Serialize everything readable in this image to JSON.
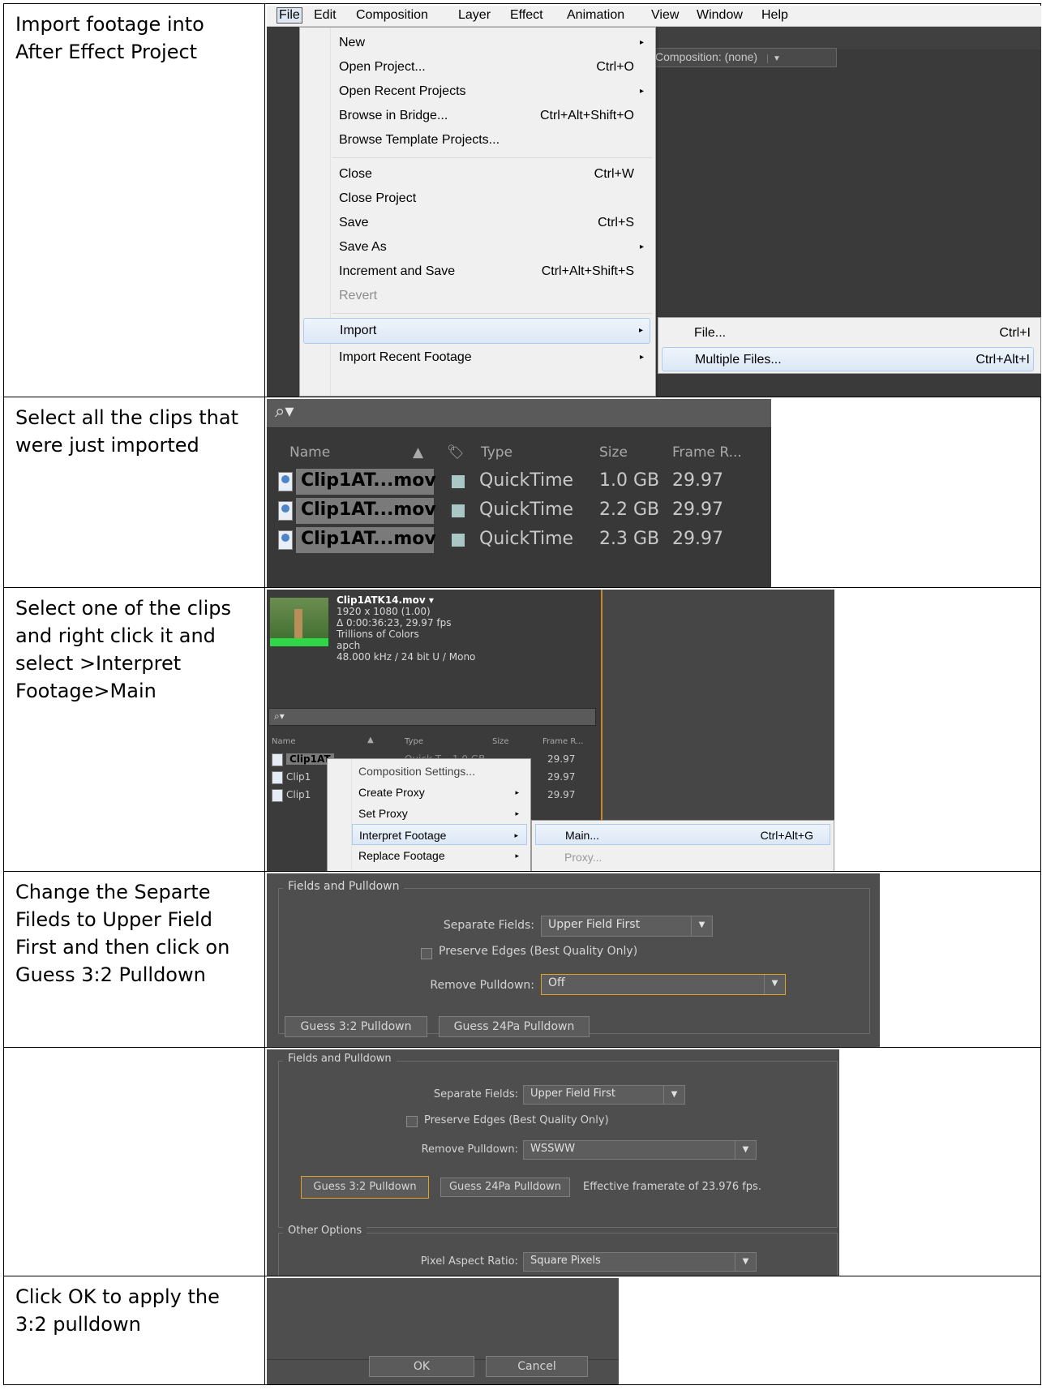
{
  "steps": [
    "Import footage into After Effect Project",
    "Select all the clips that were just imported",
    "Select one of the clips and right click it and select >Interpret Footage>Main",
    "Change the Separte Fileds to Upper Field First and then click on Guess 3:2 Pulldown",
    "",
    "Click OK to apply the 3:2 pulldown"
  ],
  "menubar": [
    "File",
    "Edit",
    "Composition",
    "Layer",
    "Effect",
    "Animation",
    "View",
    "Window",
    "Help"
  ],
  "comp_tab": "Composition: (none)",
  "file_menu": [
    {
      "label": "New",
      "shortcut": "",
      "arrow": "▸"
    },
    {
      "label": "Open Project...",
      "shortcut": "Ctrl+O",
      "arrow": ""
    },
    {
      "label": "Open Recent Projects",
      "shortcut": "",
      "arrow": "▸"
    },
    {
      "label": "Browse in Bridge...",
      "shortcut": "Ctrl+Alt+Shift+O",
      "arrow": ""
    },
    {
      "label": "Browse Template Projects...",
      "shortcut": "",
      "arrow": ""
    },
    {
      "label": "Close",
      "shortcut": "Ctrl+W",
      "arrow": ""
    },
    {
      "label": "Close Project",
      "shortcut": "",
      "arrow": ""
    },
    {
      "label": "Save",
      "shortcut": "Ctrl+S",
      "arrow": ""
    },
    {
      "label": "Save As",
      "shortcut": "",
      "arrow": "▸"
    },
    {
      "label": "Increment and Save",
      "shortcut": "Ctrl+Alt+Shift+S",
      "arrow": ""
    },
    {
      "label": "Revert",
      "shortcut": "",
      "arrow": ""
    },
    {
      "label": "Import",
      "shortcut": "",
      "arrow": "▸"
    },
    {
      "label": "Import Recent Footage",
      "shortcut": "",
      "arrow": "▸"
    }
  ],
  "import_submenu": [
    {
      "label": "File...",
      "shortcut": "Ctrl+I"
    },
    {
      "label": "Multiple Files...",
      "shortcut": "Ctrl+Alt+I"
    }
  ],
  "project_panel": {
    "search_icon": "⌕▾",
    "columns": [
      "Name",
      "Type",
      "Size",
      "Frame R..."
    ],
    "rows": [
      {
        "name": "Clip1AT...mov",
        "type": "QuickTime",
        "size": "1.0 GB",
        "fps": "29.97"
      },
      {
        "name": "Clip1AT...mov",
        "type": "QuickTime",
        "size": "2.2 GB",
        "fps": "29.97"
      },
      {
        "name": "Clip1AT...mov",
        "type": "QuickTime",
        "size": "2.3 GB",
        "fps": "29.97"
      }
    ]
  },
  "clip_info": {
    "name": "Clip1ATK14.mov ▾",
    "res": "1920 x 1080 (1.00)",
    "dur": "Δ 0:00:36:23, 29.97 fps",
    "colors": "Trillions of Colors",
    "codec": "apch",
    "audio": "48.000 kHz / 24 bit U / Mono"
  },
  "small_panel": {
    "columns": [
      "Name",
      "Type",
      "Size",
      "Frame R..."
    ],
    "rows": [
      {
        "name": "Clip1AT",
        "fps": "29.97"
      },
      {
        "name": "Clip1",
        "fps": "29.97"
      },
      {
        "name": "Clip1",
        "fps": "29.97"
      }
    ],
    "partial": "Quick T...  1.0 GB"
  },
  "context_menu": [
    {
      "label": "Composition Settings...",
      "arrow": ""
    },
    {
      "label": "Create Proxy",
      "arrow": "▸"
    },
    {
      "label": "Set Proxy",
      "arrow": "▸"
    },
    {
      "label": "Interpret Footage",
      "arrow": "▸"
    },
    {
      "label": "Replace Footage",
      "arrow": "▸"
    }
  ],
  "interpret_submenu": [
    {
      "label": "Main...",
      "shortcut": "Ctrl+Alt+G"
    },
    {
      "label": "Proxy...",
      "shortcut": ""
    }
  ],
  "dialog1": {
    "group": "Fields and Pulldown",
    "separate_label": "Separate Fields:",
    "separate_value": "Upper Field First",
    "preserve_label": "Preserve Edges (Best Quality Only)",
    "remove_label": "Remove Pulldown:",
    "remove_value": "Off",
    "guess32": "Guess 3:2 Pulldown",
    "guess24": "Guess 24Pa Pulldown"
  },
  "dialog2": {
    "group": "Fields and Pulldown",
    "separate_label": "Separate Fields:",
    "separate_value": "Upper Field First",
    "preserve_label": "Preserve Edges (Best Quality Only)",
    "remove_label": "Remove Pulldown:",
    "remove_value": "WSSWW",
    "guess32": "Guess 3:2 Pulldown",
    "guess24": "Guess 24Pa Pulldown",
    "effective": "Effective framerate of 23.976 fps.",
    "other_group": "Other Options",
    "par_label": "Pixel Aspect Ratio:",
    "par_value": "Square Pixels"
  },
  "dialog3": {
    "ok": "OK",
    "cancel": "Cancel"
  }
}
